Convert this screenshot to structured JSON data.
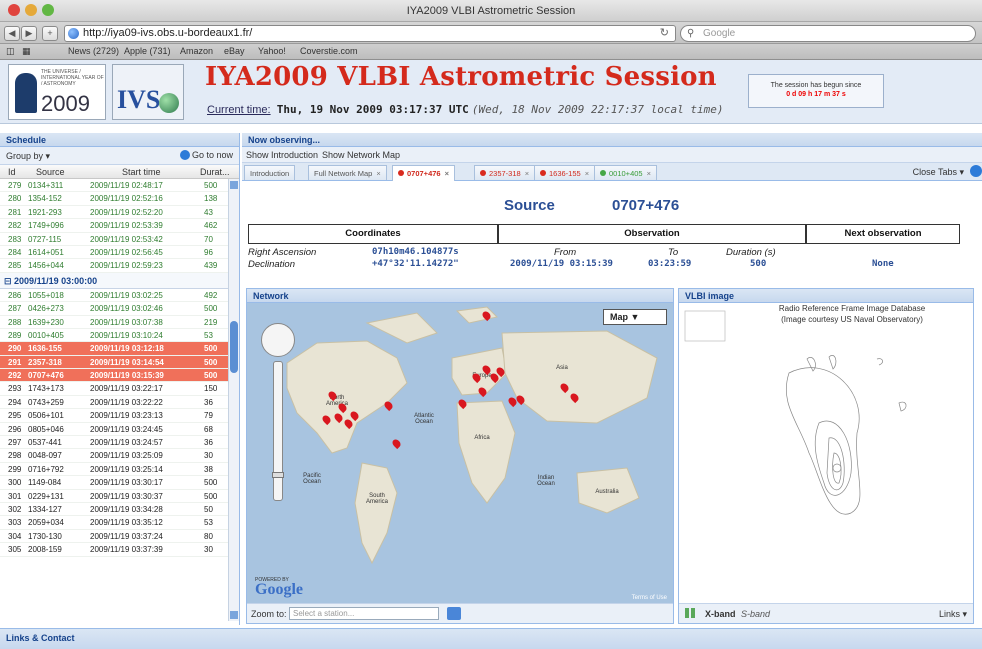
{
  "browser": {
    "window_title": "IYA2009 VLBI Astrometric Session",
    "url": "http://iya09-ivs.obs.u-bordeaux1.fr/",
    "search_placeholder": "Google",
    "bookmarks": [
      "News (2729)",
      "Apple (731)",
      "Amazon",
      "eBay",
      "Yahoo!",
      "Coverstie.com"
    ]
  },
  "header": {
    "logo_year": "2009",
    "logo_small": "THE UNIVERSE / INTERNATIONAL YEAR OF / ASTRONOMY",
    "ivs_logo": "IVS",
    "title": "IYA2009 VLBI Astrometric Session",
    "current_time_label": "Current time:",
    "utc_time": "Thu, 19 Nov 2009 03:17:37 UTC",
    "local_time": "(Wed, 18 Nov 2009 22:17:37 local time)",
    "session_line1": "The session has begun since",
    "session_line2": "0 d 09 h 17 m 37 s"
  },
  "schedule": {
    "title": "Schedule",
    "group_by": "Group by ▾",
    "go_to_now": "Go to now",
    "columns": [
      "Id",
      "Source",
      "Start time",
      "Durat..."
    ],
    "group_header": "⊟ 2009/11/19 03:00:00",
    "rows_before": [
      {
        "id": "279",
        "source": "0134+311",
        "start": "2009/11/19 02:48:17",
        "dur": "500",
        "style": "green"
      },
      {
        "id": "280",
        "source": "1354-152",
        "start": "2009/11/19 02:52:16",
        "dur": "138",
        "style": "green"
      },
      {
        "id": "281",
        "source": "1921-293",
        "start": "2009/11/19 02:52:20",
        "dur": "43",
        "style": "green"
      },
      {
        "id": "282",
        "source": "1749+096",
        "start": "2009/11/19 02:53:39",
        "dur": "462",
        "style": "green"
      },
      {
        "id": "283",
        "source": "0727-115",
        "start": "2009/11/19 02:53:42",
        "dur": "70",
        "style": "green"
      },
      {
        "id": "284",
        "source": "1614+051",
        "start": "2009/11/19 02:56:45",
        "dur": "96",
        "style": "green"
      },
      {
        "id": "285",
        "source": "1456+044",
        "start": "2009/11/19 02:59:23",
        "dur": "439",
        "style": "green"
      }
    ],
    "rows_after": [
      {
        "id": "286",
        "source": "1055+018",
        "start": "2009/11/19 03:02:25",
        "dur": "492",
        "style": "green"
      },
      {
        "id": "287",
        "source": "0426+273",
        "start": "2009/11/19 03:02:46",
        "dur": "500",
        "style": "green"
      },
      {
        "id": "288",
        "source": "1639+230",
        "start": "2009/11/19 03:07:38",
        "dur": "219",
        "style": "green"
      },
      {
        "id": "289",
        "source": "0010+405",
        "start": "2009/11/19 03:10:24",
        "dur": "53",
        "style": "green"
      },
      {
        "id": "290",
        "source": "1636-155",
        "start": "2009/11/19 03:12:18",
        "dur": "500",
        "style": "red"
      },
      {
        "id": "291",
        "source": "2357-318",
        "start": "2009/11/19 03:14:54",
        "dur": "500",
        "style": "red"
      },
      {
        "id": "292",
        "source": "0707+476",
        "start": "2009/11/19 03:15:39",
        "dur": "500",
        "style": "red"
      },
      {
        "id": "293",
        "source": "1743+173",
        "start": "2009/11/19 03:22:17",
        "dur": "150",
        "style": "black"
      },
      {
        "id": "294",
        "source": "0743+259",
        "start": "2009/11/19 03:22:22",
        "dur": "36",
        "style": "black"
      },
      {
        "id": "295",
        "source": "0506+101",
        "start": "2009/11/19 03:23:13",
        "dur": "79",
        "style": "black"
      },
      {
        "id": "296",
        "source": "0805+046",
        "start": "2009/11/19 03:24:45",
        "dur": "68",
        "style": "black"
      },
      {
        "id": "297",
        "source": "0537-441",
        "start": "2009/11/19 03:24:57",
        "dur": "36",
        "style": "black"
      },
      {
        "id": "298",
        "source": "0048-097",
        "start": "2009/11/19 03:25:09",
        "dur": "30",
        "style": "black"
      },
      {
        "id": "299",
        "source": "0716+792",
        "start": "2009/11/19 03:25:14",
        "dur": "38",
        "style": "black"
      },
      {
        "id": "300",
        "source": "1149-084",
        "start": "2009/11/19 03:30:17",
        "dur": "500",
        "style": "black"
      },
      {
        "id": "301",
        "source": "0229+131",
        "start": "2009/11/19 03:30:37",
        "dur": "500",
        "style": "black"
      },
      {
        "id": "302",
        "source": "1334-127",
        "start": "2009/11/19 03:34:28",
        "dur": "50",
        "style": "black"
      },
      {
        "id": "303",
        "source": "2059+034",
        "start": "2009/11/19 03:35:12",
        "dur": "53",
        "style": "black"
      },
      {
        "id": "304",
        "source": "1730-130",
        "start": "2009/11/19 03:37:24",
        "dur": "80",
        "style": "black"
      },
      {
        "id": "305",
        "source": "2008-159",
        "start": "2009/11/19 03:37:39",
        "dur": "30",
        "style": "black"
      }
    ]
  },
  "observing": {
    "title": "Now observing...",
    "show_intro": "Show Introduction",
    "show_network": "Show Network Map",
    "close_tabs": "Close Tabs ▾",
    "tabs": [
      {
        "label": "Introduction",
        "style": "plain"
      },
      {
        "label": "Full Network Map",
        "style": "plain"
      },
      {
        "label": "0707+476",
        "style": "active"
      },
      {
        "label": "2357-318",
        "style": "red"
      },
      {
        "label": "1636-155",
        "style": "red"
      },
      {
        "label": "0010+405",
        "style": "green"
      }
    ],
    "source_label": "Source",
    "source_value": "0707+476",
    "headers": {
      "coordinates": "Coordinates",
      "observation": "Observation",
      "next": "Next observation"
    },
    "ra_label": "Right Ascension",
    "ra_value": "07h10m46.104877s",
    "dec_label": "Declination",
    "dec_value": "+47°32'11.14272\"",
    "from_label": "From",
    "from_value": "2009/11/19  03:15:39",
    "to_label": "To",
    "to_value": "03:23:59",
    "duration_label": "Duration (s)",
    "duration_value": "500",
    "next_value": "None"
  },
  "network": {
    "title": "Network",
    "map_type": "Map",
    "labels": {
      "north_america": "North America",
      "south_america": "South America",
      "europe": "Europe",
      "asia": "Asia",
      "africa": "Africa",
      "australia": "Australia",
      "atlantic": "Atlantic Ocean",
      "pacific": "Pacific Ocean",
      "indian": "Indian Ocean"
    },
    "google": "Google",
    "powered_by": "POWERED BY",
    "terms": "Terms of Use",
    "zoom_to": "Zoom to:",
    "zoom_placeholder": "Select a station..."
  },
  "vlbi": {
    "title": "VLBI image",
    "caption_line1": "Radio Reference Frame Image Database",
    "caption_line2": "(Image courtesy US Naval Observatory)",
    "xband": "X-band",
    "sband": "S-band",
    "links": "Links ▾"
  },
  "footer": {
    "links_contact": "Links & Contact"
  },
  "colors": {
    "title_red": "#d42a1c",
    "accent_blue": "#2b4f95",
    "row_green": "#2f7d2f",
    "row_red": "#f0705a"
  }
}
